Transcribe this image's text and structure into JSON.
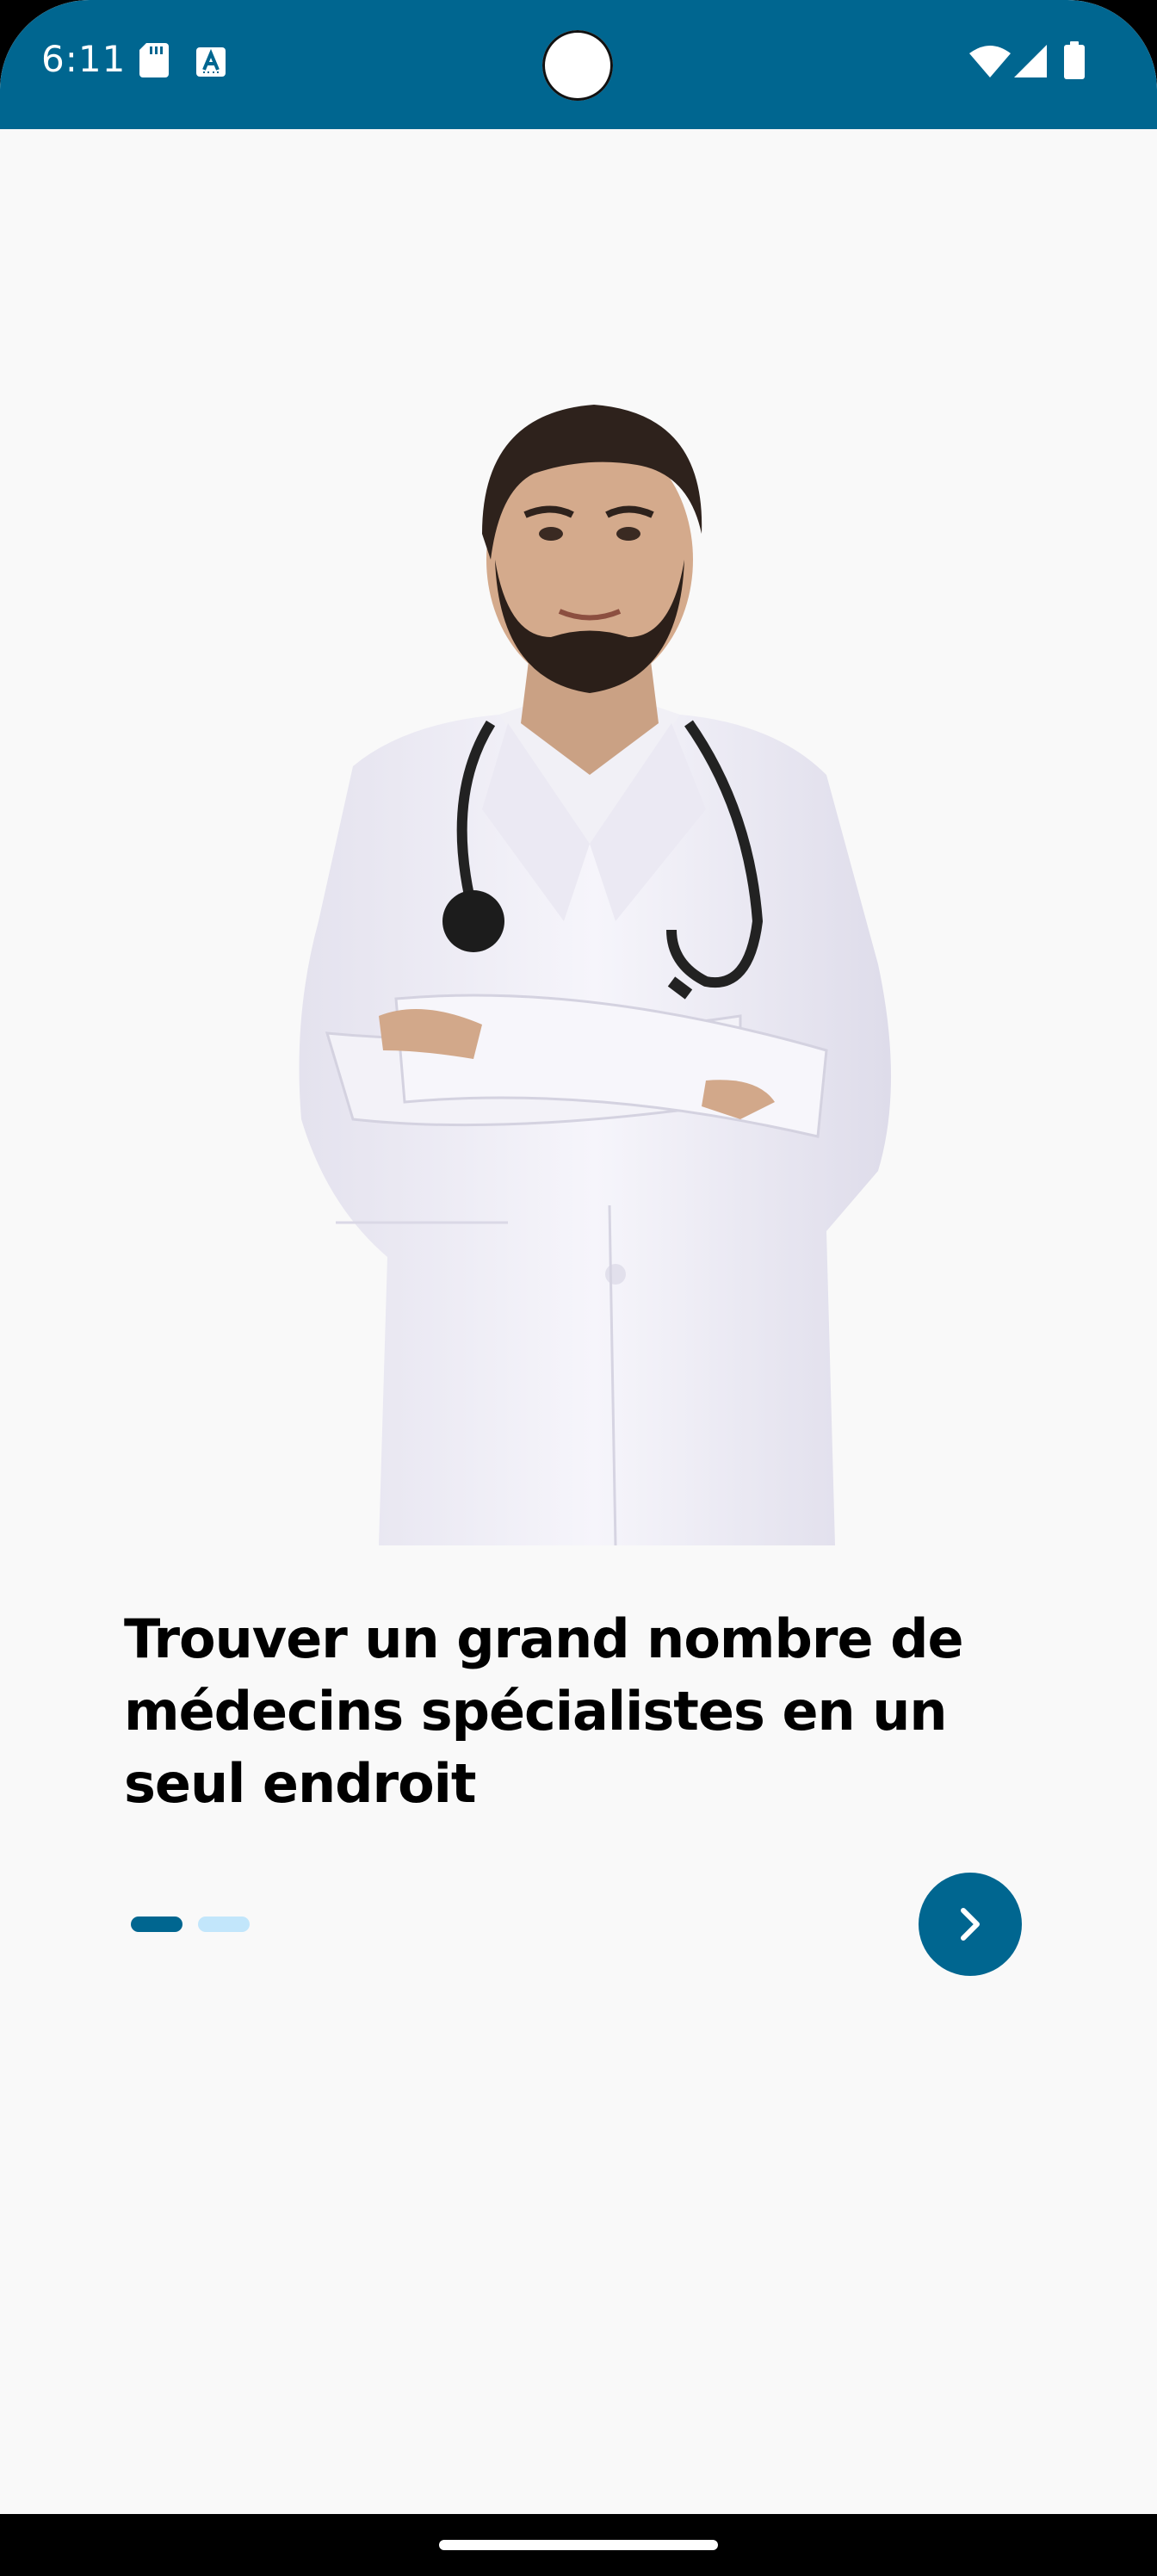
{
  "status_bar": {
    "time": "6:11",
    "left_icons": [
      "sd-card-icon",
      "keyboard-a-icon"
    ],
    "right_icons": [
      "wifi-icon",
      "cellular-signal-icon",
      "battery-icon"
    ]
  },
  "onboarding": {
    "hero_image": "doctor-illustration",
    "headline": "Trouver un grand nombre de médecins spécialistes en un seul endroit",
    "page_indicator": {
      "total_pages": 2,
      "current_page": 1
    },
    "next_button_icon": "chevron-right-icon"
  },
  "colors": {
    "status_bar": "#006690",
    "background": "#f9f9f9",
    "accent": "#006690",
    "indicator_active": "#006690",
    "indicator_inactive": "#c2e6fb",
    "text": "#000000"
  }
}
